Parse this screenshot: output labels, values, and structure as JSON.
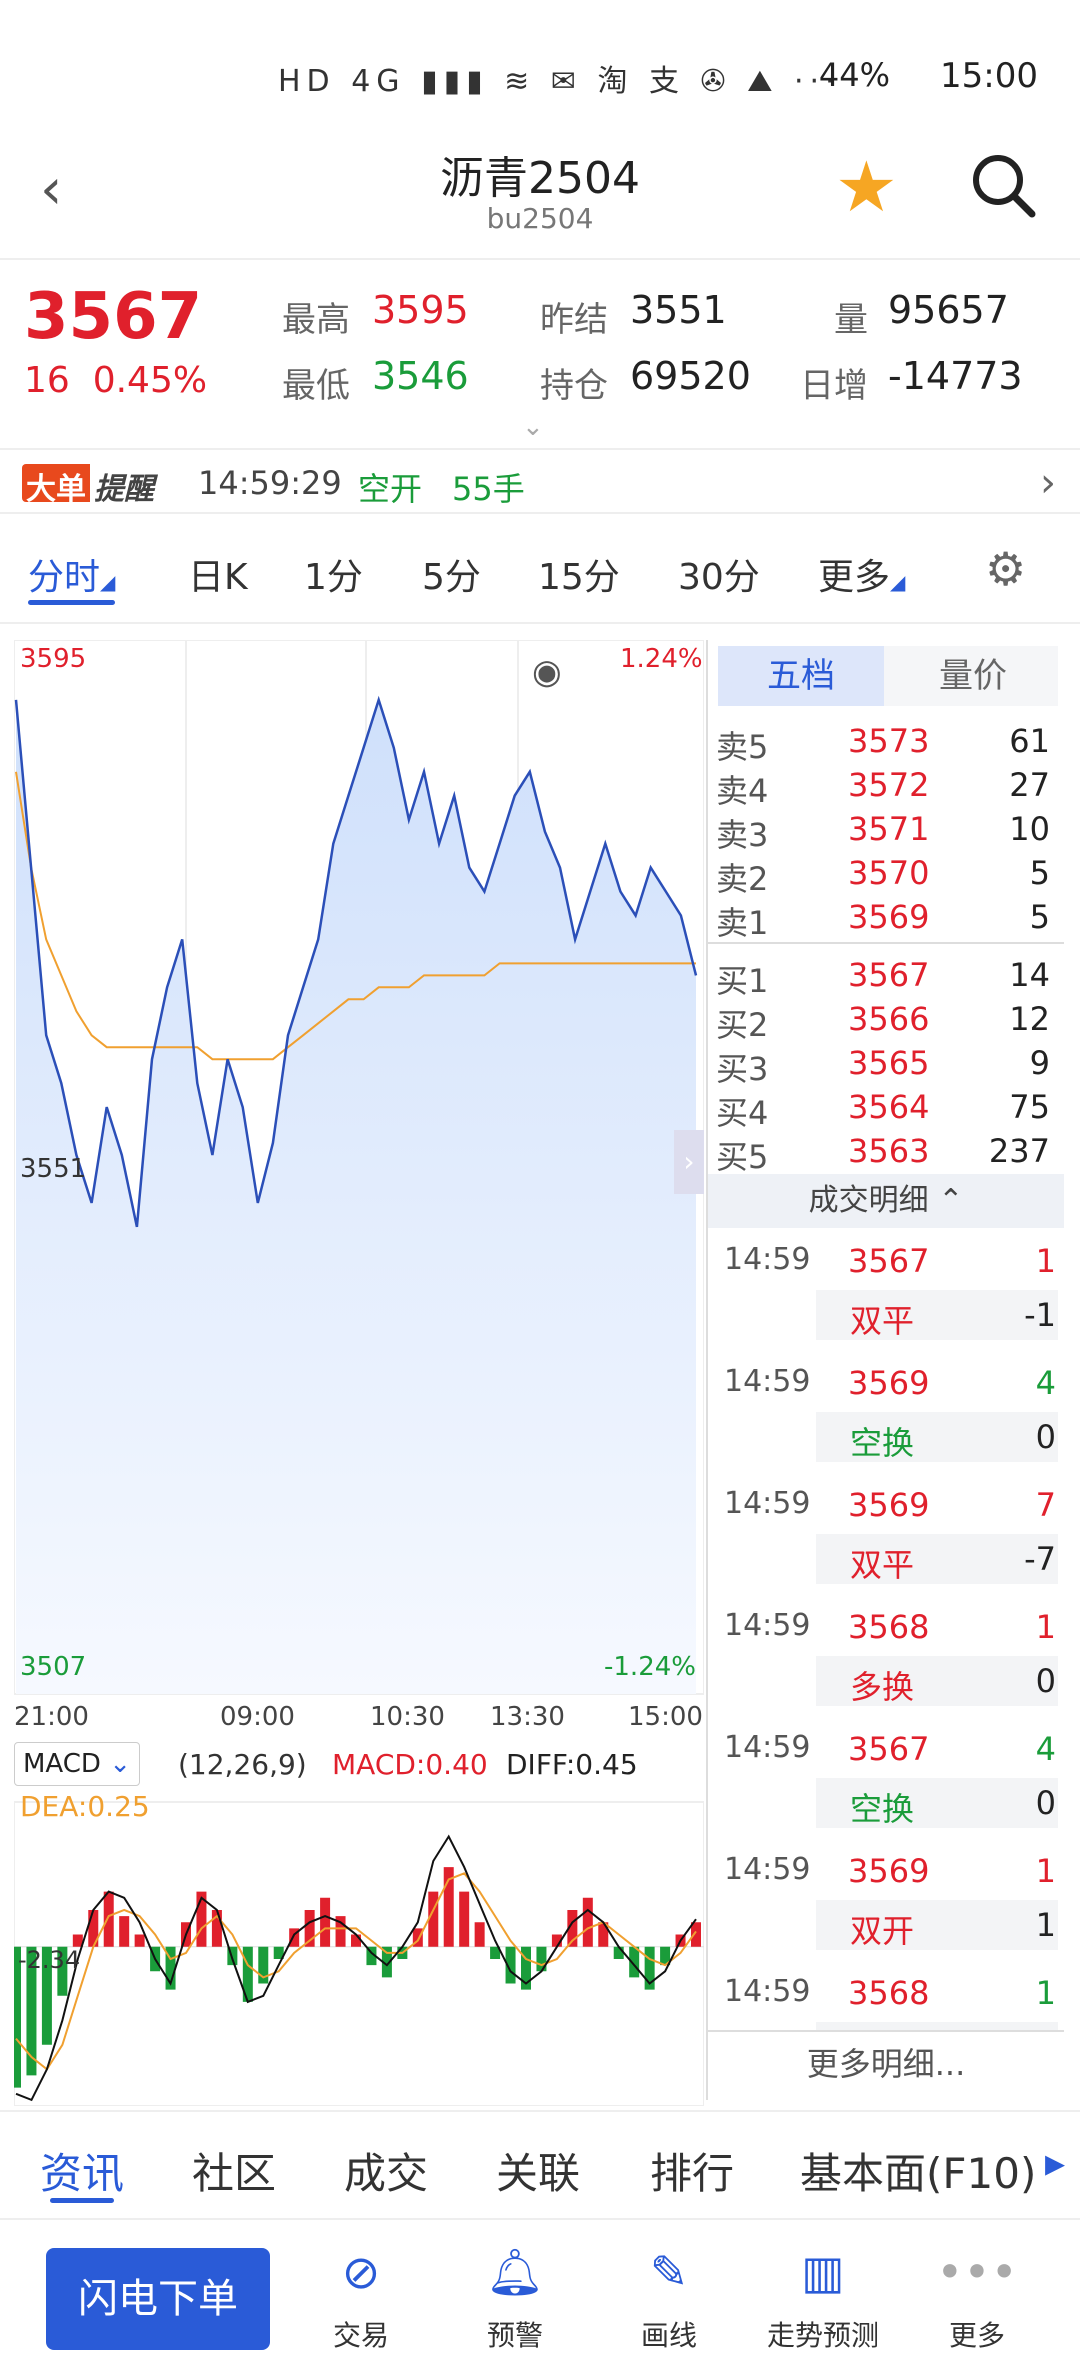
{
  "status": {
    "time": "15:00",
    "battery": "44%",
    "icons": "HD 4G ▮▮▮ ≋ ✉ 淘 支 ✇ ⛰ ···"
  },
  "header": {
    "title": "沥青2504",
    "subtitle": "bu2504"
  },
  "quote": {
    "price": "3567",
    "change": "16",
    "change_pct": "0.45%",
    "high_label": "最高",
    "high": "3595",
    "low_label": "最低",
    "low": "3546",
    "prev_settle_label": "昨结",
    "prev_settle": "3551",
    "oi_label": "持仓",
    "oi": "69520",
    "vol_label": "量",
    "vol": "95657",
    "daily_inc_label": "日增",
    "daily_inc": "-14773"
  },
  "alert": {
    "badge1": "大单",
    "badge2": "提醒",
    "time": "14:59:29",
    "type": "空开",
    "qty": "55手"
  },
  "tabs": [
    "分时",
    "日K",
    "1分",
    "5分",
    "15分",
    "30分",
    "更多"
  ],
  "chart": {
    "top_price": "3595",
    "top_pct": "1.24%",
    "mid_price": "3551",
    "bottom_price": "3507",
    "bottom_pct": "-1.24%",
    "time_labels": [
      "21:00",
      "09:00",
      "10:30",
      "13:30",
      "15:00"
    ],
    "macd_selector": "MACD",
    "macd_params": "(12,26,9)",
    "macd_value": "MACD:0.40",
    "diff_value": "DIFF:0.45",
    "dea_value": "DEA:0.25",
    "macd_low": "-2.34",
    "colors": {
      "up": "#e0202c",
      "down": "#1a9c3a",
      "price_line": "#2b4fb8",
      "avg_line": "#f0a030"
    }
  },
  "chart_data": {
    "type": "line",
    "title": "",
    "ylim": [
      3507,
      3595
    ],
    "xticks": [
      "21:00",
      "09:00",
      "10:30",
      "13:30",
      "15:00"
    ],
    "series": [
      {
        "values": [
          3590,
          3576,
          3562,
          3558,
          3552,
          3548,
          3556,
          3552,
          3546,
          3560,
          3566,
          3570,
          3558,
          3552,
          3560,
          3556,
          3548,
          3553,
          3562,
          3566,
          3570,
          3578,
          3582,
          3586,
          3590,
          3586,
          3580,
          3584,
          3578,
          3582,
          3576,
          3574,
          3578,
          3582,
          3584,
          3579,
          3576,
          3570,
          3574,
          3578,
          3574,
          3572,
          3576,
          3574,
          3572,
          3567
        ]
      },
      {
        "values": [
          3584,
          3576,
          3570,
          3567,
          3564,
          3562,
          3561,
          3561,
          3561,
          3561,
          3561,
          3561,
          3561,
          3560,
          3560,
          3560,
          3560,
          3560,
          3561,
          3562,
          3563,
          3564,
          3565,
          3565,
          3566,
          3566,
          3566,
          3567,
          3567,
          3567,
          3567,
          3567,
          3568,
          3568,
          3568,
          3568,
          3568,
          3568,
          3568,
          3568,
          3568,
          3568,
          3568,
          3568,
          3568,
          3568
        ]
      }
    ],
    "macd": {
      "ylim": [
        -2.6,
        2.2
      ],
      "hist": [
        -2.3,
        -2.1,
        -1.6,
        -0.8,
        0.2,
        0.6,
        0.9,
        0.5,
        0.2,
        -0.4,
        -0.7,
        0.4,
        0.9,
        0.6,
        -0.3,
        -0.9,
        -0.6,
        -0.2,
        0.3,
        0.6,
        0.8,
        0.5,
        0.2,
        -0.3,
        -0.5,
        -0.2,
        0.3,
        0.9,
        1.3,
        0.9,
        0.4,
        -0.2,
        -0.6,
        -0.7,
        -0.4,
        0.2,
        0.6,
        0.8,
        0.4,
        -0.2,
        -0.5,
        -0.7,
        -0.3,
        0.2,
        0.4
      ],
      "diff": [
        -2.4,
        -2.5,
        -2.0,
        -1.2,
        -0.2,
        0.6,
        0.9,
        0.8,
        0.4,
        -0.2,
        -0.6,
        0.2,
        0.8,
        0.6,
        -0.2,
        -0.9,
        -0.8,
        -0.3,
        0.2,
        0.4,
        0.5,
        0.4,
        0.2,
        -0.1,
        -0.3,
        0.0,
        0.4,
        1.4,
        1.8,
        1.3,
        0.7,
        0.1,
        -0.4,
        -0.6,
        -0.4,
        0.0,
        0.4,
        0.6,
        0.4,
        0.0,
        -0.3,
        -0.6,
        -0.4,
        0.1,
        0.45
      ],
      "dea": [
        -1.5,
        -1.8,
        -2.0,
        -1.6,
        -0.8,
        0.0,
        0.5,
        0.6,
        0.5,
        0.2,
        -0.2,
        -0.1,
        0.3,
        0.5,
        0.2,
        -0.3,
        -0.5,
        -0.4,
        -0.1,
        0.1,
        0.3,
        0.3,
        0.3,
        0.1,
        -0.1,
        -0.1,
        0.1,
        0.6,
        1.1,
        1.2,
        0.9,
        0.5,
        0.1,
        -0.2,
        -0.3,
        -0.2,
        0.1,
        0.3,
        0.4,
        0.2,
        0.0,
        -0.2,
        -0.3,
        -0.1,
        0.25
      ]
    }
  },
  "orderbook": {
    "tab_5": "五档",
    "tab_lj": "量价",
    "asks": [
      {
        "label": "卖5",
        "price": "3573",
        "vol": "61"
      },
      {
        "label": "卖4",
        "price": "3572",
        "vol": "27"
      },
      {
        "label": "卖3",
        "price": "3571",
        "vol": "10"
      },
      {
        "label": "卖2",
        "price": "3570",
        "vol": "5"
      },
      {
        "label": "卖1",
        "price": "3569",
        "vol": "5"
      }
    ],
    "bids": [
      {
        "label": "买1",
        "price": "3567",
        "vol": "14"
      },
      {
        "label": "买2",
        "price": "3566",
        "vol": "12"
      },
      {
        "label": "买3",
        "price": "3565",
        "vol": "9"
      },
      {
        "label": "买4",
        "price": "3564",
        "vol": "75"
      },
      {
        "label": "买5",
        "price": "3563",
        "vol": "237"
      }
    ],
    "trade_head": "成交明细 ⌃",
    "trades": [
      {
        "time": "14:59",
        "price": "3567",
        "vol": "1",
        "kind": "双平",
        "delta": "-1",
        "dir": "up"
      },
      {
        "time": "14:59",
        "price": "3569",
        "vol": "4",
        "kind": "空换",
        "delta": "0",
        "dir": "down"
      },
      {
        "time": "14:59",
        "price": "3569",
        "vol": "7",
        "kind": "双平",
        "delta": "-7",
        "dir": "up"
      },
      {
        "time": "14:59",
        "price": "3568",
        "vol": "1",
        "kind": "多换",
        "delta": "0",
        "dir": "up"
      },
      {
        "time": "14:59",
        "price": "3567",
        "vol": "4",
        "kind": "空换",
        "delta": "0",
        "dir": "down"
      },
      {
        "time": "14:59",
        "price": "3569",
        "vol": "1",
        "kind": "双开",
        "delta": "1",
        "dir": "up"
      },
      {
        "time": "14:59",
        "price": "3568",
        "vol": "1",
        "kind": "",
        "delta": "",
        "dir": "down"
      }
    ],
    "more": "更多明细..."
  },
  "bottom_tabs": [
    "资讯",
    "社区",
    "成交",
    "关联",
    "排行",
    "基本面(F10)"
  ],
  "dock": {
    "flash": "闪电下单",
    "items": [
      "交易",
      "预警",
      "画线",
      "走势预测",
      "更多"
    ]
  }
}
